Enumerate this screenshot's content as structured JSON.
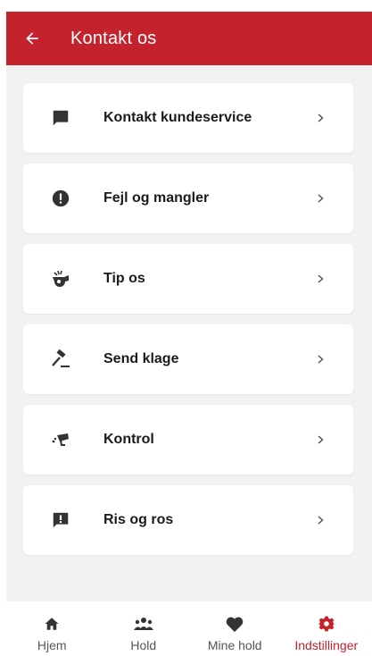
{
  "header": {
    "title": "Kontakt os",
    "back_icon": "arrow-left-icon"
  },
  "menu": {
    "items": [
      {
        "label": "Kontakt kundeservice",
        "icon": "chat-icon"
      },
      {
        "label": "Fejl og mangler",
        "icon": "exclamation-circle-icon"
      },
      {
        "label": "Tip os",
        "icon": "whistle-icon"
      },
      {
        "label": "Send klage",
        "icon": "gavel-icon"
      },
      {
        "label": "Kontrol",
        "icon": "camera-icon"
      },
      {
        "label": "Ris og ros",
        "icon": "feedback-icon"
      }
    ],
    "chevron_icon": "chevron-right-icon"
  },
  "tabs": [
    {
      "label": "Hjem",
      "icon": "home-icon",
      "active": false
    },
    {
      "label": "Hold",
      "icon": "group-icon",
      "active": false
    },
    {
      "label": "Mine hold",
      "icon": "heart-icon",
      "active": false
    },
    {
      "label": "Indstillinger",
      "icon": "gear-icon",
      "active": true
    }
  ],
  "colors": {
    "brand": "#c4232e",
    "background": "#f2f2f2",
    "card": "#ffffff",
    "icon": "#333333",
    "tab_inactive": "#555555"
  }
}
